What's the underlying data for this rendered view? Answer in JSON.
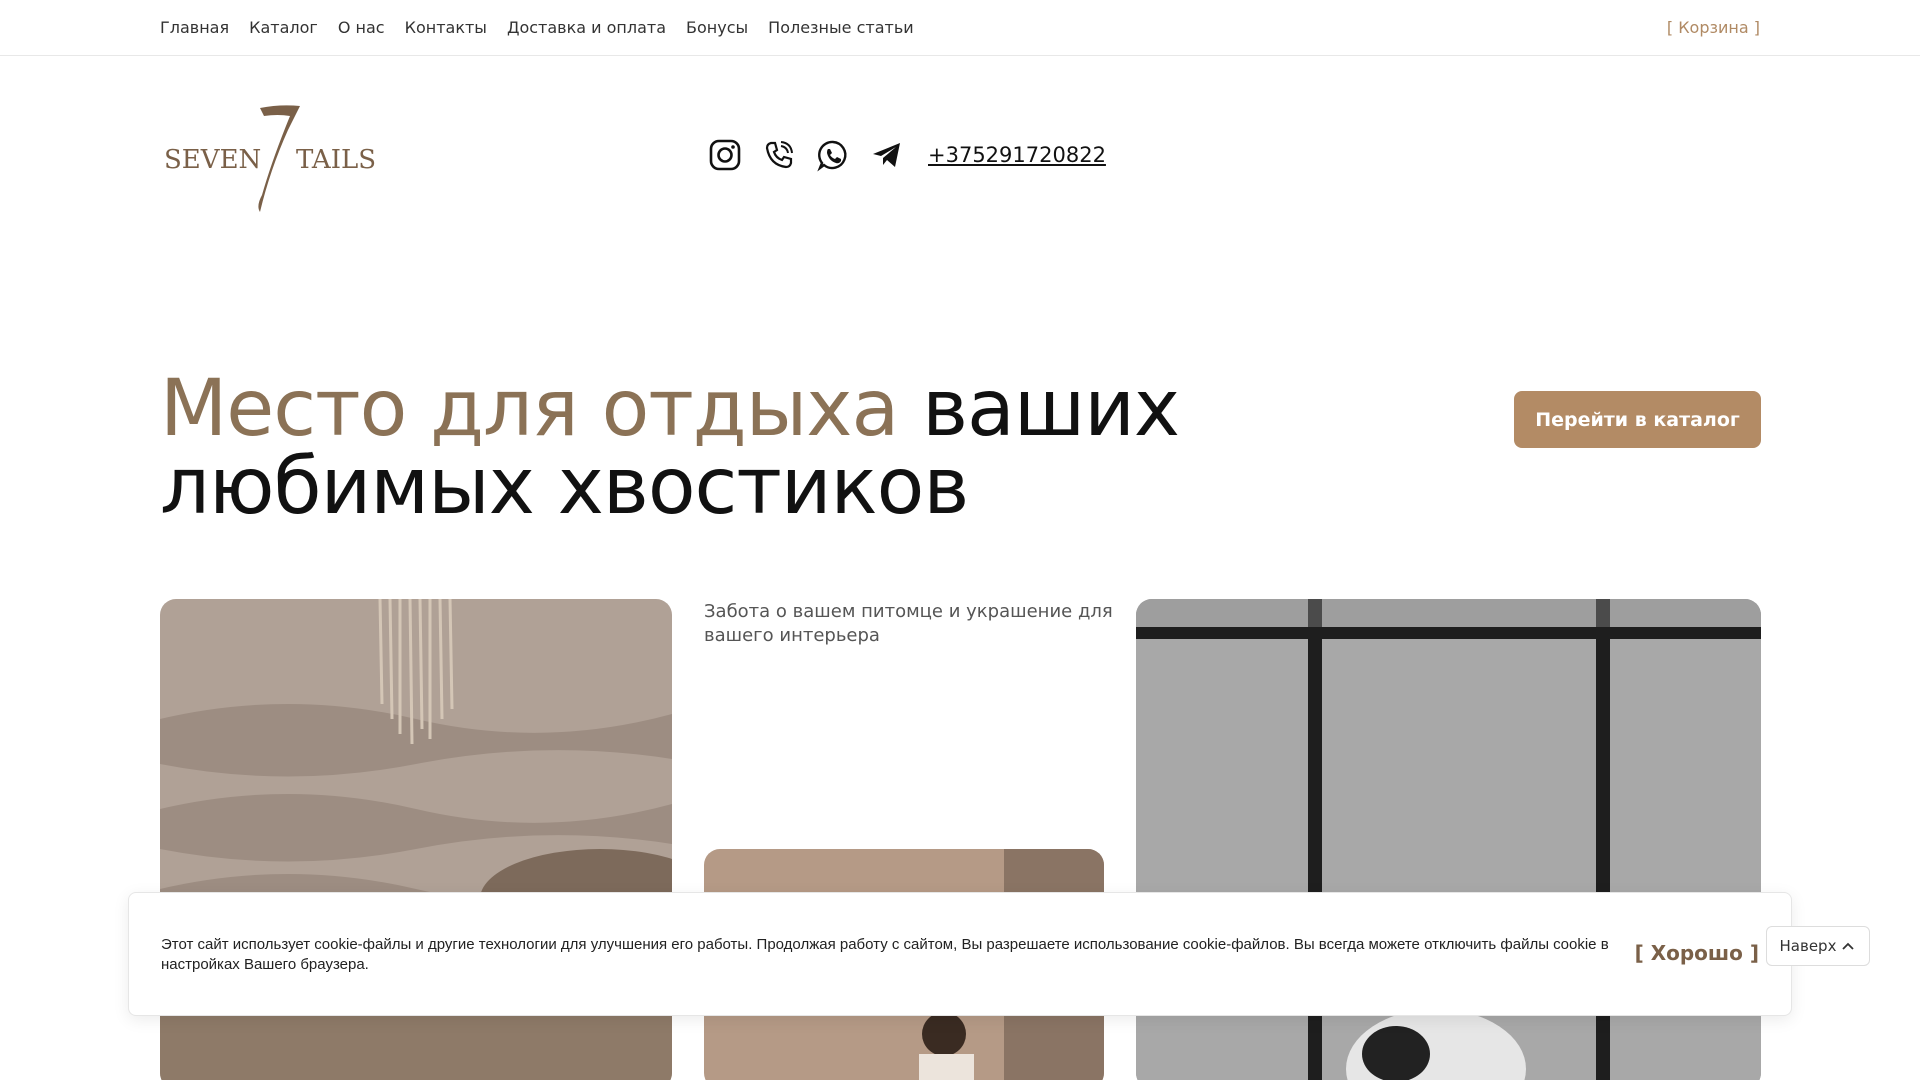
{
  "nav": {
    "items": [
      "Главная",
      "Каталог",
      "О нас",
      "Контакты",
      "Доставка и оплата",
      "Бонусы",
      "Полезные статьи"
    ],
    "cart": "[ Корзина ]"
  },
  "logo": {
    "left_word": "SEVEN",
    "right_word": "TAILS",
    "mark": "7"
  },
  "contacts": {
    "icons": [
      "instagram-icon",
      "viber-icon",
      "whatsapp-icon",
      "telegram-icon"
    ],
    "phone": "+375291720822"
  },
  "hero": {
    "title_accent": "Место для отдыха",
    "title_rest": "ваших любимых хвостиков",
    "cta": "Перейти в каталог"
  },
  "tagline": "Забота о вашем питомце и украшение для вашего интерьера",
  "cookie": {
    "text": "Этот сайт использует cookie-файлы и другие технологии для улучшения его работы. Продолжая работу с сайтом, Вы разрешаете использование cookie-файлов. Вы всегда можете отключить файлы cookie в настройках Вашего браузера.",
    "button": "[ Хорошо ]"
  },
  "scroll_top": {
    "label": "Наверх"
  },
  "colors": {
    "accent": "#b38b65",
    "accent_dark": "#8b7256",
    "cart": "#b08a64"
  }
}
